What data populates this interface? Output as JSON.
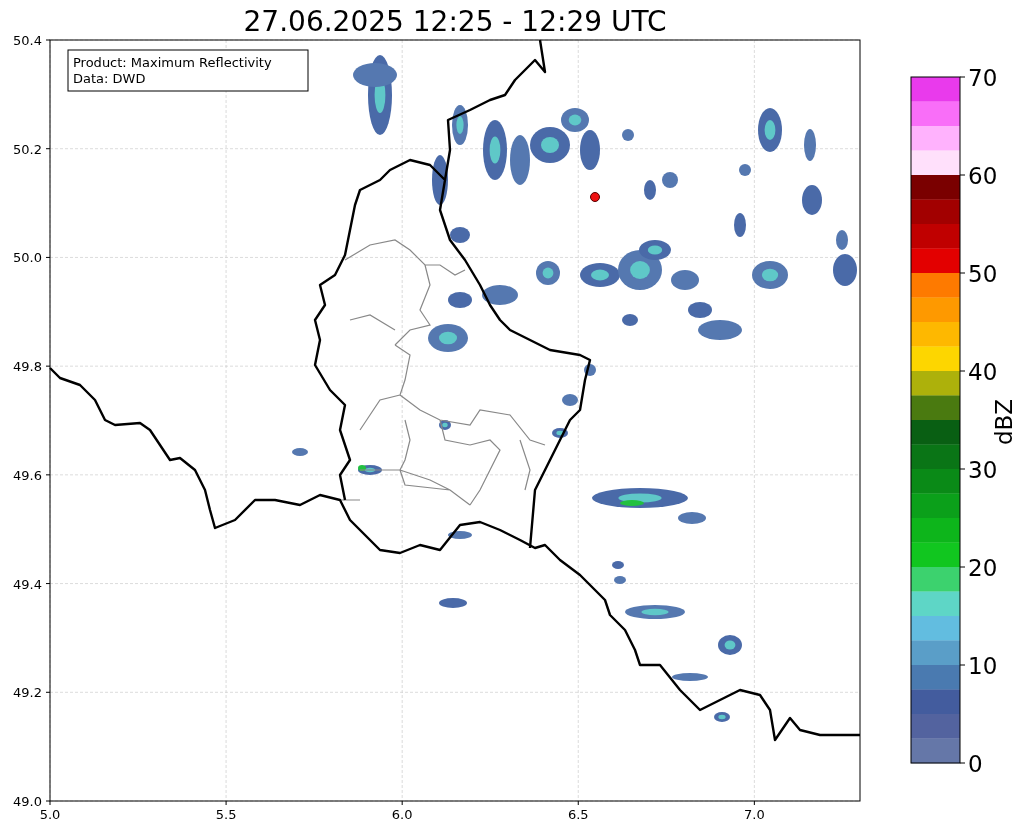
{
  "title": "27.06.2025 12:25 - 12:29 UTC",
  "annotation": [
    "Product: Maximum Reflectivity",
    "Data: DWD"
  ],
  "x_axis": {
    "ticks": [
      "5.0",
      "5.5",
      "6.0",
      "6.5",
      "7.0"
    ]
  },
  "y_axis": {
    "ticks": [
      "50.4",
      "50.2",
      "50.0",
      "49.8",
      "49.6",
      "49.4",
      "49.2",
      "49.0"
    ]
  },
  "colorbar": {
    "label": "dBZ",
    "ticks": [
      "70",
      "60",
      "50",
      "40",
      "30",
      "20",
      "10",
      "0"
    ],
    "bins": [
      {
        "color": "#e93aec"
      },
      {
        "color": "#f96ef8"
      },
      {
        "color": "#ffb2fd"
      },
      {
        "color": "#ffe0fb"
      },
      {
        "color": "#7a0000"
      },
      {
        "color": "#a20000"
      },
      {
        "color": "#c00000"
      },
      {
        "color": "#e30000"
      },
      {
        "color": "#fe7a00"
      },
      {
        "color": "#fe9900"
      },
      {
        "color": "#feb800"
      },
      {
        "color": "#fdd600"
      },
      {
        "color": "#adb10b"
      },
      {
        "color": "#4a7a10"
      },
      {
        "color": "#095f13"
      },
      {
        "color": "#0a7516"
      },
      {
        "color": "#0a8a17"
      },
      {
        "color": "#0ba01a"
      },
      {
        "color": "#0db51b"
      },
      {
        "color": "#11c61f"
      },
      {
        "color": "#3cd26e"
      },
      {
        "color": "#5ed6c6"
      },
      {
        "color": "#62bde0"
      },
      {
        "color": "#5a9ec8"
      },
      {
        "color": "#4a7ab0"
      },
      {
        "color": "#435c9e"
      },
      {
        "color": "#53639f"
      },
      {
        "color": "#6577a8"
      }
    ]
  }
}
